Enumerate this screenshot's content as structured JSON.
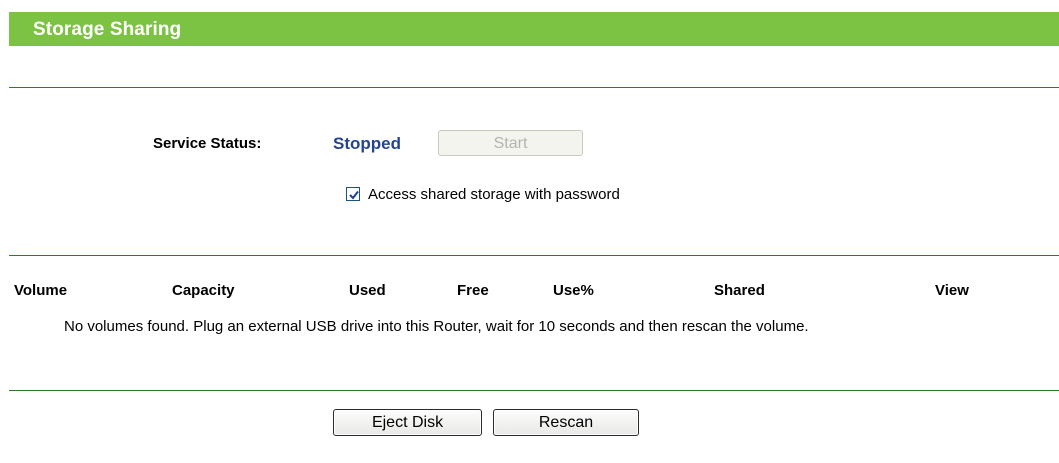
{
  "header": {
    "title": "Storage Sharing"
  },
  "service": {
    "status_label": "Service Status:",
    "status_value": "Stopped",
    "start_label": "Start",
    "password_checkbox": {
      "label": "Access shared storage with password",
      "checked": true
    }
  },
  "table": {
    "columns": [
      "Volume",
      "Capacity",
      "Used",
      "Free",
      "Use%",
      "Shared",
      "View"
    ],
    "empty_message": "No volumes found. Plug an external USB drive into this Router, wait for 10 seconds and then rescan the volume."
  },
  "actions": {
    "eject_label": "Eject Disk",
    "rescan_label": "Rescan"
  },
  "colors": {
    "header_bg": "#7cc243",
    "divider": "#2f7a2f",
    "status_value": "#27458e"
  }
}
